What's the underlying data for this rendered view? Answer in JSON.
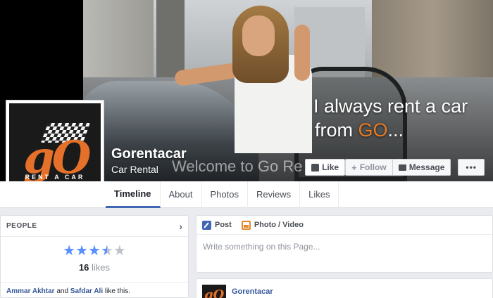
{
  "cover": {
    "slogan_line1": "I always rent a car",
    "slogan_line2_prefix": "from ",
    "slogan_line2_brand": "GO",
    "slogan_line2_suffix": "...",
    "welcome_text": "Welcome to Go Re",
    "brand_orange": "#e87a22"
  },
  "profile": {
    "logo_text": "gO",
    "logo_subtext": "RENT A CAR"
  },
  "page": {
    "name": "Gorentacar",
    "category": "Car Rental"
  },
  "actions": {
    "like": "Like",
    "follow": "Follow",
    "message": "Message",
    "more": "•••"
  },
  "tabs": [
    {
      "label": "Timeline",
      "active": true
    },
    {
      "label": "About"
    },
    {
      "label": "Photos"
    },
    {
      "label": "Reviews"
    },
    {
      "label": "Likes"
    }
  ],
  "people": {
    "title": "PEOPLE",
    "rating": 3.5,
    "rating_max": 5,
    "likes_number": "16",
    "likes_label": "likes",
    "friend1": "Ammar Akhtar",
    "and": " and ",
    "friend2": "Safdar Ali",
    "suffix": " like this."
  },
  "composer": {
    "post_tab": "Post",
    "photo_tab": "Photo / Video",
    "placeholder": "Write something on this Page..."
  },
  "post": {
    "author": "Gorentacar",
    "avatar_text": "gO"
  },
  "colors": {
    "accent": "#4267b2",
    "link": "#365899",
    "star": "#5890ff"
  }
}
